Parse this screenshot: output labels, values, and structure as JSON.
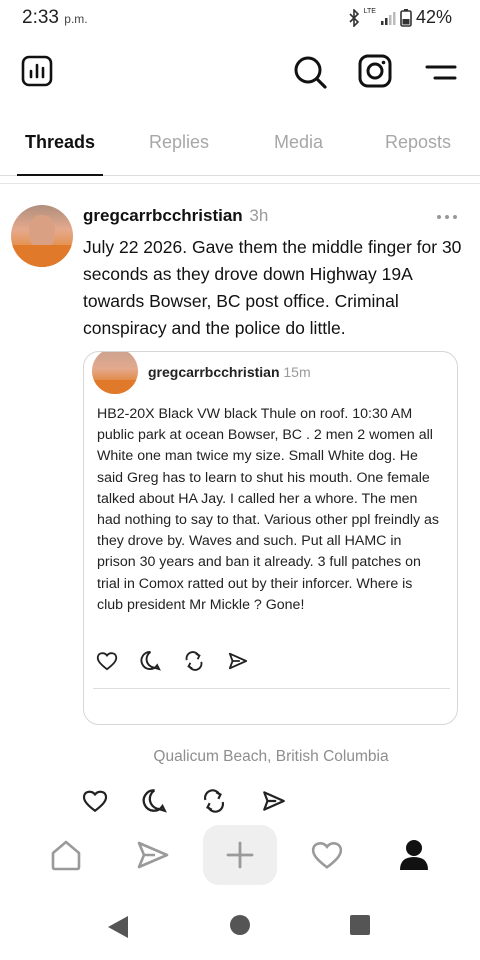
{
  "status": {
    "time": "2:33",
    "time_suffix": "p.m.",
    "network": "LTE",
    "battery": "42%"
  },
  "top_bar": {
    "icons": [
      "activity-chart-icon",
      "search-icon",
      "instagram-icon",
      "menu-icon"
    ]
  },
  "tabs": [
    {
      "label": "Threads",
      "active": true
    },
    {
      "label": "Replies",
      "active": false
    },
    {
      "label": "Media",
      "active": false
    },
    {
      "label": "Reposts",
      "active": false
    }
  ],
  "post": {
    "author": "gregcarrbcchristian",
    "time_ago": "3h",
    "text": "July 22 2026.  Gave them the middle finger for 30 seconds as they drove down Highway 19A  towards Bowser, BC post office. Criminal conspiracy and the police do little.",
    "quote": {
      "author": "gregcarrbcchristian",
      "time_ago": "15m",
      "text": "HB2-20X Black VW black Thule on roof. 10:30 AM public park at ocean Bowser, BC . 2 men 2 women all White one man twice my size. Small White dog.  He said Greg has to learn to shut his mouth. One female talked about HA Jay. I called her a whore. The men had nothing to say to that. Various other ppl freindly as they drove by. Waves and such. Put all HAMC in prison 30 years and ban it already. 3 full patches on trial in Comox ratted out by their inforcer. Where is club president Mr Mickle ? Gone!"
    },
    "location": "Qualicum Beach, British Columbia"
  },
  "bottom_nav": {
    "items": [
      "home-icon",
      "send-icon",
      "create-plus-icon",
      "heart-icon",
      "profile-icon"
    ]
  },
  "colors": {
    "accent": "#111111",
    "muted": "#a7a7a7",
    "create_bg": "#efefef"
  }
}
